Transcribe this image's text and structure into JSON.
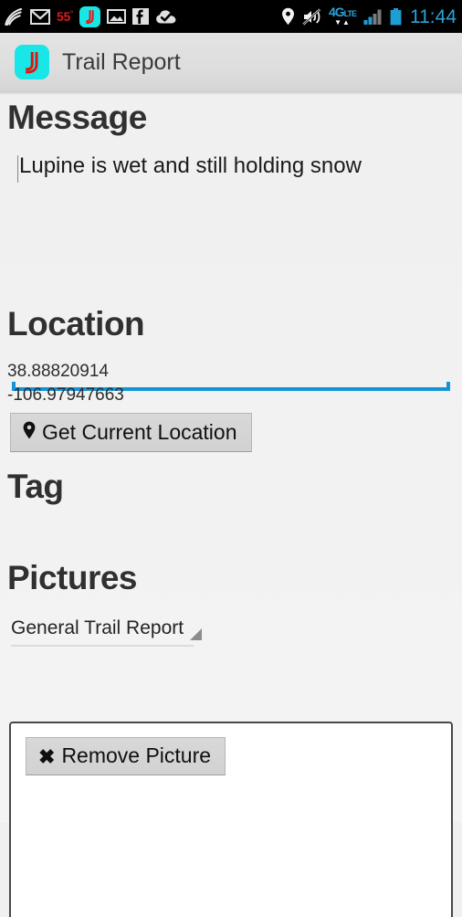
{
  "status_bar": {
    "icons_left": [
      {
        "name": "wifi-signal-icon",
        "glyph": "wifi"
      },
      {
        "name": "gmail-icon",
        "glyph": "M"
      },
      {
        "name": "temperature-indicator",
        "value": "55",
        "unit": "°"
      },
      {
        "name": "trail-report-app-icon",
        "glyph": "J"
      },
      {
        "name": "photo-icon",
        "glyph": "image"
      },
      {
        "name": "facebook-icon",
        "glyph": "f"
      },
      {
        "name": "cloud-check-icon",
        "glyph": "check"
      }
    ],
    "icons_right": [
      {
        "name": "location-pin-icon"
      },
      {
        "name": "mute-icon"
      },
      {
        "name": "network-4g-lte-icon",
        "label": "4G",
        "sub": "LTE"
      },
      {
        "name": "cell-signal-icon"
      },
      {
        "name": "battery-icon"
      }
    ],
    "clock": "11:44",
    "accent_color": "#2aa3d8",
    "temp_color": "#d81e1e"
  },
  "app_bar": {
    "icon_name": "trail-report-app-icon",
    "icon_bg": "#19e6e6",
    "icon_fg": "#e8100f",
    "title": "Trail Report"
  },
  "form": {
    "message": {
      "heading": "Message",
      "value": "Lupine is wet and still holding snow",
      "underline_color": "#1295d8"
    },
    "location": {
      "heading": "Location",
      "latitude": "38.88820914",
      "longitude": "-106.97947663",
      "button_label": "Get Current Location",
      "button_icon": "map-pin-icon"
    },
    "tag": {
      "heading": "Tag",
      "selected": "General Trail Report"
    },
    "pictures": {
      "heading": "Pictures",
      "remove_button_label": "Remove Picture",
      "remove_button_icon": "x-icon"
    }
  }
}
